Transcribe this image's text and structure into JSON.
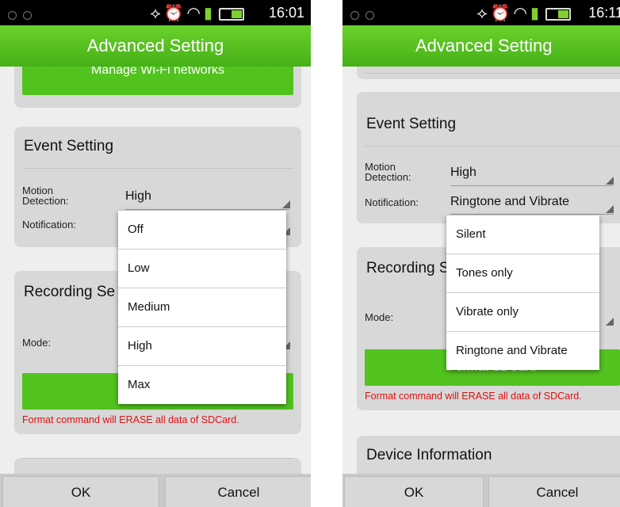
{
  "colors": {
    "accent_green": "#52c21f",
    "title_green": "#5cc322",
    "warning_red": "#e01010"
  },
  "left": {
    "status": {
      "time": "16:01"
    },
    "title": "Advanced Setting",
    "manage_wifi_label": "Manage Wi-Fi networks",
    "event_setting": {
      "title": "Event Setting",
      "motion_label": "Motion\nDetection:",
      "motion_value": "High",
      "notification_label": "Notification:"
    },
    "recording": {
      "title": "Recording Se",
      "mode_label": "Mode:",
      "format_label": "Fo"
    },
    "warning": "Format command will ERASE all data of SDCard.",
    "dropdown": {
      "options": [
        "Off",
        "Low",
        "Medium",
        "High",
        "Max"
      ]
    },
    "ok_label": "OK",
    "cancel_label": "Cancel"
  },
  "right": {
    "status": {
      "time": "16:11"
    },
    "title": "Advanced Setting",
    "event_setting": {
      "title": "Event Setting",
      "motion_label": "Motion\nDetection:",
      "motion_value": "High",
      "notification_label": "Notification:",
      "notification_value": "Ringtone and Vibrate"
    },
    "recording": {
      "title": "Recording Se",
      "mode_label": "Mode:",
      "format_label": "Format SDCard"
    },
    "warning": "Format command will ERASE all data of SDCard.",
    "device_info_title": "Device Information",
    "dropdown": {
      "options": [
        "Silent",
        "Tones only",
        "Vibrate only",
        "Ringtone and Vibrate"
      ]
    },
    "ok_label": "OK",
    "cancel_label": "Cancel"
  }
}
